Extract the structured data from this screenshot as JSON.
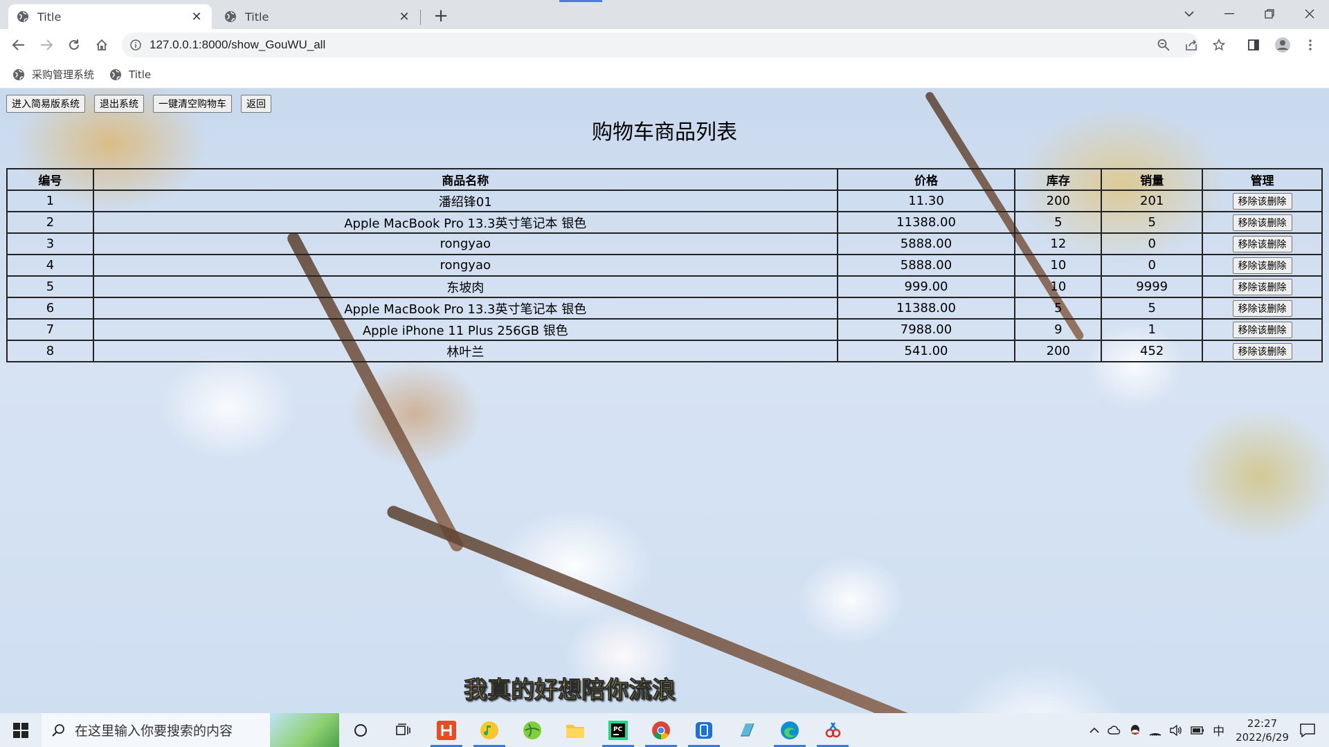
{
  "browser": {
    "tabs": [
      {
        "title": "Title",
        "active": true
      },
      {
        "title": "Title",
        "active": false
      }
    ],
    "url": "127.0.0.1:8000/show_GouWU_all",
    "bookmarks": [
      {
        "label": "采购管理系统"
      },
      {
        "label": "Title"
      }
    ]
  },
  "page": {
    "buttons": [
      "进入简易版系统",
      "退出系统",
      "一键清空购物车",
      "返回"
    ],
    "title": "购物车商品列表",
    "table": {
      "headers": [
        "编号",
        "商品名称",
        "价格",
        "库存",
        "销量",
        "管理"
      ],
      "action_label": "移除该删除",
      "rows": [
        {
          "id": "1",
          "name": "潘绍锋01",
          "price": "11.30",
          "stock": "200",
          "sales": "201"
        },
        {
          "id": "2",
          "name": "Apple MacBook Pro 13.3英寸笔记本 银色",
          "price": "11388.00",
          "stock": "5",
          "sales": "5"
        },
        {
          "id": "3",
          "name": "rongyao",
          "price": "5888.00",
          "stock": "12",
          "sales": "0"
        },
        {
          "id": "4",
          "name": "rongyao",
          "price": "5888.00",
          "stock": "10",
          "sales": "0"
        },
        {
          "id": "5",
          "name": "东坡肉",
          "price": "999.00",
          "stock": "10",
          "sales": "9999"
        },
        {
          "id": "6",
          "name": "Apple MacBook Pro 13.3英寸笔记本 银色",
          "price": "11388.00",
          "stock": "5",
          "sales": "5"
        },
        {
          "id": "7",
          "name": "Apple iPhone 11 Plus 256GB 银色",
          "price": "7988.00",
          "stock": "9",
          "sales": "1"
        },
        {
          "id": "8",
          "name": "林叶兰",
          "price": "541.00",
          "stock": "200",
          "sales": "452"
        }
      ]
    },
    "video_subtitle": "我真的好想陪你流浪"
  },
  "taskbar": {
    "search_placeholder": "在这里输入你要搜索的内容",
    "time": "22:27",
    "date": "2022/6/29",
    "ime": "中"
  },
  "colors": {
    "tab_strip": "#dee1e6",
    "omnibox": "#f1f3f4",
    "taskbar": "#e8eef5",
    "subtitle": "#f3e24a"
  }
}
